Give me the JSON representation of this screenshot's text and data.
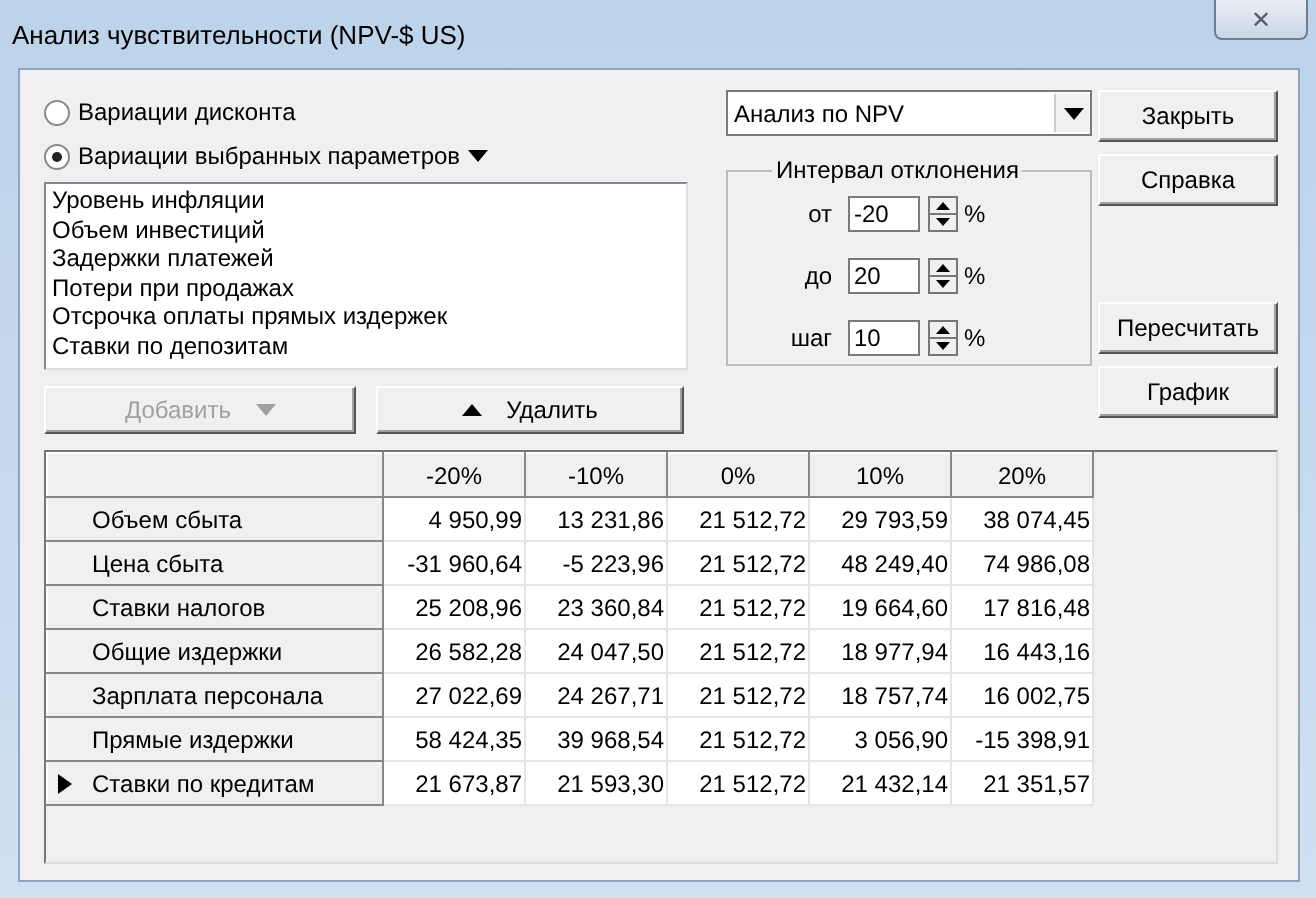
{
  "window": {
    "title": "Анализ чувствительности (NPV-$ US)",
    "close_label": "✕"
  },
  "mode_options": [
    {
      "label": "Вариации дисконта",
      "selected": false,
      "menu": false
    },
    {
      "label": "Вариации выбранных параметров",
      "selected": true,
      "menu": true
    }
  ],
  "parameter_list": [
    "Уровень инфляции",
    "Объем инвестиций",
    "Задержки платежей",
    "Потери при продажах",
    "Отсрочка оплаты прямых издержек",
    "Ставки по депозитам"
  ],
  "list_buttons": [
    {
      "label": "Добавить",
      "disabled": true,
      "kind": "dropdown"
    },
    {
      "label": "Удалить",
      "disabled": false,
      "kind": "remove"
    }
  ],
  "analysis_select": {
    "value": "Анализ по NPV"
  },
  "interval": {
    "title": "Интервал отклонения",
    "fields": [
      {
        "label": "от",
        "value": "-20",
        "unit": "%"
      },
      {
        "label": "до",
        "value": "20",
        "unit": "%"
      },
      {
        "label": "шаг",
        "value": "10",
        "unit": "%"
      }
    ]
  },
  "top_buttons": [
    "Закрыть",
    "Справка"
  ],
  "bottom_buttons": [
    "Пересчитать",
    "График"
  ],
  "table": {
    "columns": [
      "-20%",
      "-10%",
      "0%",
      "10%",
      "20%"
    ],
    "rows": [
      {
        "name": "Объем сбыта",
        "selected": false,
        "values": [
          "4 950,99",
          "13 231,86",
          "21 512,72",
          "29 793,59",
          "38 074,45"
        ]
      },
      {
        "name": "Цена сбыта",
        "selected": false,
        "values": [
          "-31 960,64",
          "-5 223,96",
          "21 512,72",
          "48 249,40",
          "74 986,08"
        ]
      },
      {
        "name": "Ставки налогов",
        "selected": false,
        "values": [
          "25 208,96",
          "23 360,84",
          "21 512,72",
          "19 664,60",
          "17 816,48"
        ]
      },
      {
        "name": "Общие издержки",
        "selected": false,
        "values": [
          "26 582,28",
          "24 047,50",
          "21 512,72",
          "18 977,94",
          "16 443,16"
        ]
      },
      {
        "name": "Зарплата персонала",
        "selected": false,
        "values": [
          "27 022,69",
          "24 267,71",
          "21 512,72",
          "18 757,74",
          "16 002,75"
        ]
      },
      {
        "name": "Прямые издержки",
        "selected": false,
        "values": [
          "58 424,35",
          "39 968,54",
          "21 512,72",
          "3 056,90",
          "-15 398,91"
        ]
      },
      {
        "name": "Ставки по кредитам",
        "selected": true,
        "values": [
          "21 673,87",
          "21 593,30",
          "21 512,72",
          "21 432,14",
          "21 351,57"
        ]
      }
    ]
  }
}
